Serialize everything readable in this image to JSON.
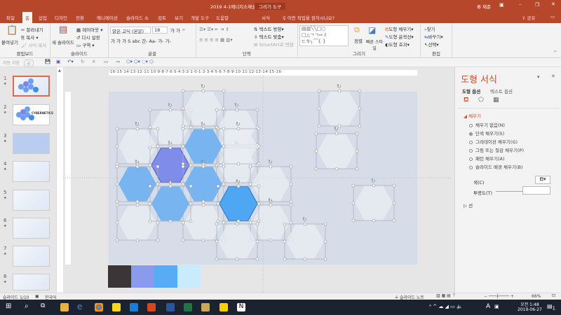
{
  "title": "2019 4-1에너지소재설계MVP 3조",
  "context_tab": "그리기 도구",
  "user": "류 재준",
  "window_controls": [
    "ribbon-display",
    "minimize",
    "restore",
    "close"
  ],
  "tabs": [
    "파일",
    "홈",
    "삽입",
    "디자인",
    "전환",
    "애니메이션",
    "슬라이드 쇼",
    "검토",
    "보기",
    "개발 도구",
    "도움말",
    "서식"
  ],
  "active_tab": "홈",
  "tell_me": "어떤 작업을 원하시나요?",
  "share": "공유",
  "ribbon": {
    "clipboard": {
      "label": "클립보드",
      "paste": "붙여넣기",
      "cut": "잘라내기",
      "copy": "복사",
      "format_painter": "서식 복사"
    },
    "slides": {
      "label": "슬라이드",
      "new_slide": "새 슬라이드",
      "layout": "레이아웃",
      "reset": "다시 설정",
      "section": "구역"
    },
    "font": {
      "label": "글꼴",
      "font_name": "맑은 고딕 (본문)",
      "font_size": "18",
      "row2": "가 가 가 S abc 간- Aa- 가- 가-"
    },
    "paragraph": {
      "label": "단락",
      "text_direction": "텍스트 방향",
      "align_text": "텍스트 맞춤",
      "smartart": "SmartArt로 변환"
    },
    "drawing": {
      "label": "그리기",
      "arrange": "정렬",
      "quick_styles": "빠른 스타일",
      "shape_fill": "도형 채우기",
      "shape_outline": "도형 윤곽선",
      "shape_effects": "도형 효과"
    },
    "editing": {
      "label": "편집",
      "find": "찾기",
      "replace": "바꾸기",
      "select": "선택"
    }
  },
  "qat": {
    "autosave": "자동 저장",
    "autosave_state": "끔"
  },
  "slides": [
    {
      "num": "1",
      "star": "★"
    },
    {
      "num": "2",
      "star": "★",
      "title": "CYBERNETICS"
    },
    {
      "num": "3",
      "star": "★"
    },
    {
      "num": "4",
      "star": "★"
    },
    {
      "num": "5",
      "star": "★"
    },
    {
      "num": "6",
      "star": "★"
    },
    {
      "num": "7",
      "star": "★"
    },
    {
      "num": "8",
      "star": "★"
    }
  ],
  "ruler_h": "·16·15·14·13·12·11·10·9·8·7·6·5·4·3·2·1·0·1·2·3·4·5·6·7·8·9·10·11·12·13·14·15·16·",
  "palette": [
    "#3a3637",
    "#8a9bee",
    "#58abf5",
    "#c8ecfd"
  ],
  "pane": {
    "title": "도형 서식",
    "tabs": [
      "도형 옵션",
      "텍스트 옵션"
    ],
    "section_fill": "채우기",
    "fill_options": [
      {
        "label": "채우기 없음(N)",
        "checked": false
      },
      {
        "label": "단색 채우기(S)",
        "checked": true
      },
      {
        "label": "그라데이션 채우기(G)",
        "checked": false
      },
      {
        "label": "그림 또는 질감 채우기(P)",
        "checked": false
      },
      {
        "label": "패턴 채우기(A)",
        "checked": false
      },
      {
        "label": "슬라이드 배경 채우기(B)",
        "checked": false
      }
    ],
    "color_label": "색(C)",
    "transparency_label": "투명도(T)",
    "transparency_value": "",
    "section_line": "선"
  },
  "status": {
    "slide": "슬라이드 1/10",
    "language": "한국어",
    "notes": "슬라이드 노트",
    "zoom": "66%"
  },
  "taskbar": {
    "time": "오전 1:48",
    "date": "2019-06-27",
    "notification_count": "1",
    "ime": "A"
  }
}
